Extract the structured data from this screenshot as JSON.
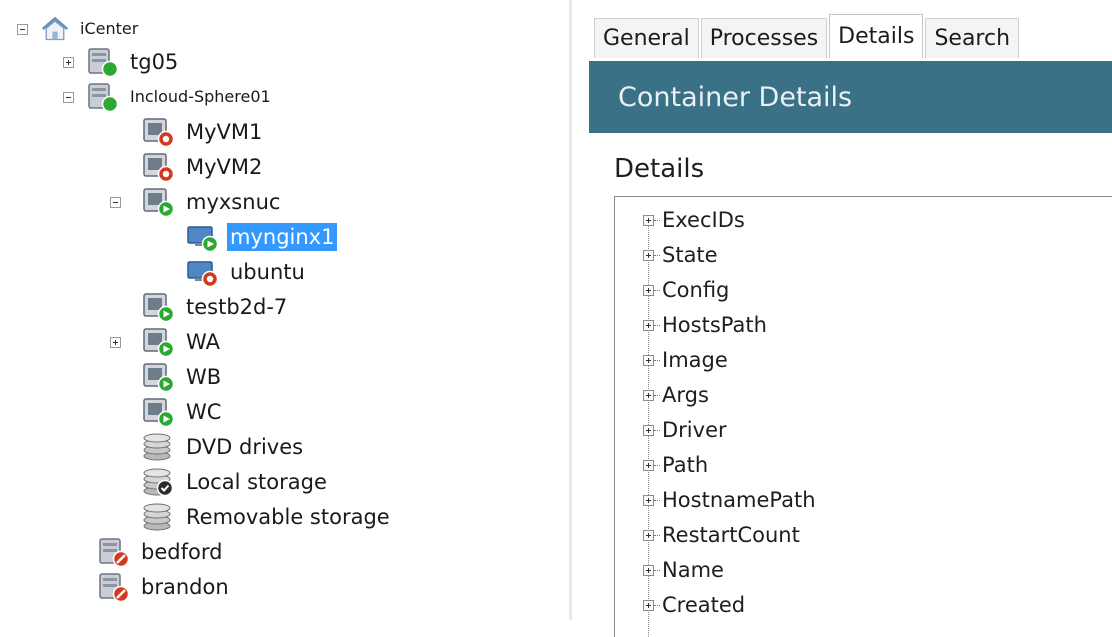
{
  "tree": {
    "root": {
      "label": "iCenter"
    },
    "items": [
      {
        "label": "tg05",
        "expander": "plus"
      },
      {
        "label": "Incloud-Sphere01",
        "expander": "minus"
      },
      {
        "label": "MyVM1"
      },
      {
        "label": "MyVM2"
      },
      {
        "label": "myxsnuc",
        "expander": "minus"
      },
      {
        "label": "mynginx1",
        "selected": true
      },
      {
        "label": "ubuntu"
      },
      {
        "label": "testb2d-7"
      },
      {
        "label": "WA",
        "expander": "plus"
      },
      {
        "label": "WB"
      },
      {
        "label": "WC"
      },
      {
        "label": "DVD drives"
      },
      {
        "label": "Local storage"
      },
      {
        "label": "Removable storage"
      },
      {
        "label": "bedford"
      },
      {
        "label": "brandon"
      }
    ]
  },
  "tabs": [
    {
      "label": "General"
    },
    {
      "label": "Processes"
    },
    {
      "label": "Details",
      "active": true
    },
    {
      "label": "Search"
    }
  ],
  "banner": {
    "title": "Container Details"
  },
  "details": {
    "section_title": "Details",
    "items": [
      "ExecIDs",
      "State",
      "Config",
      "HostsPath",
      "Image",
      "Args",
      "Driver",
      "Path",
      "HostnamePath",
      "RestartCount",
      "Name",
      "Created"
    ]
  },
  "colors": {
    "banner": "#3b7186",
    "selection": "#3399ff",
    "status_running": "#2aa832",
    "status_stopped": "#d23a1e"
  }
}
